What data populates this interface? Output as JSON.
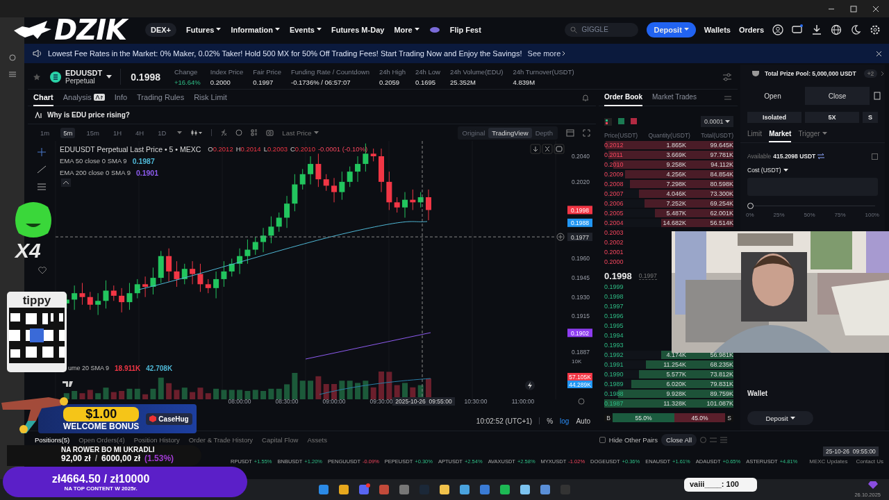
{
  "overlay_logo": {
    "text": "DZIK"
  },
  "nav": {
    "items": [
      {
        "label": "DEX+",
        "kind": "pill"
      },
      {
        "label": "Futures",
        "kind": "menu"
      },
      {
        "label": "Information",
        "kind": "menu"
      },
      {
        "label": "Events",
        "kind": "menu"
      },
      {
        "label": "Futures M-Day",
        "kind": "plain"
      },
      {
        "label": "More",
        "kind": "menu"
      },
      {
        "label": "Flip Fest",
        "kind": "promo"
      }
    ],
    "search": {
      "placeholder": "GIGGLE"
    },
    "deposit": "Deposit",
    "links": [
      "Wallets",
      "Orders"
    ]
  },
  "banner": {
    "text": "Lowest Fee Rates in the Market: 0% Maker, 0.02% Taker! Hold 500 MX for 50% Off Trading Fees! Start Trading Now and Enjoy the Savings!",
    "link": "See more"
  },
  "ticker": {
    "symbol": "EDUUSDT",
    "type": "Perpetual",
    "price": "0.1998",
    "stats": [
      {
        "label": "Change",
        "value": "+16.64%",
        "kind": "up"
      },
      {
        "label": "Index Price",
        "value": "0.2000",
        "kind": "plain"
      },
      {
        "label": "Fair Price",
        "value": "0.1997",
        "kind": "plain"
      },
      {
        "label": "Funding Rate / Countdown",
        "value": "-0.1736% / 06:57:07",
        "kind": "plain"
      },
      {
        "label": "24h High",
        "value": "0.2059",
        "kind": "plain"
      },
      {
        "label": "24h Low",
        "value": "0.1695",
        "kind": "plain"
      },
      {
        "label": "24h Volume(EDU)",
        "value": "25.352M",
        "kind": "plain"
      },
      {
        "label": "24h Turnover(USDT)",
        "value": "4.839M",
        "kind": "plain"
      }
    ]
  },
  "chart_tabs": [
    {
      "label": "Chart",
      "selected": true,
      "kind": "plain"
    },
    {
      "label": "Analysis",
      "selected": false,
      "kind": "ai"
    },
    {
      "label": "Info",
      "selected": false,
      "kind": "plain"
    },
    {
      "label": "Trading Rules",
      "selected": false,
      "kind": "plain"
    },
    {
      "label": "Risk Limit",
      "selected": false,
      "kind": "plain"
    }
  ],
  "insight": "Why is EDU price rising?",
  "intervals": [
    {
      "label": "1m",
      "selected": false
    },
    {
      "label": "5m",
      "selected": true
    },
    {
      "label": "15m",
      "selected": false
    },
    {
      "label": "1H",
      "selected": false
    },
    {
      "label": "4H",
      "selected": false
    },
    {
      "label": "1D",
      "selected": false
    }
  ],
  "price_source": "Last Price",
  "views": [
    {
      "label": "Original",
      "selected": false
    },
    {
      "label": "TradingView",
      "selected": true
    },
    {
      "label": "Depth",
      "selected": false
    }
  ],
  "chart": {
    "legend_title": "EDUUSDT Perpetual Last Price • 5 • MEXC",
    "ohlc": [
      {
        "label": "O",
        "value": "0.2012"
      },
      {
        "label": "H",
        "value": "0.2014"
      },
      {
        "label": "L",
        "value": "0.2003"
      },
      {
        "label": "C",
        "value": "0.2010"
      }
    ],
    "change": "-0.0001 (-0.10%)",
    "indicators": [
      {
        "label": "EMA 50 close 0 SMA 9",
        "value": "0.1987",
        "color": "#4fb8d6"
      },
      {
        "label": "EMA 200 close 0 SMA 9",
        "value": "0.1901",
        "color": "#8e5cf0"
      }
    ],
    "volume_label": "ume 20 SMA 9",
    "volume_values": [
      {
        "value": "18.911K",
        "color": "#f23645"
      },
      {
        "value": "42.708K",
        "color": "#4fb8d6"
      }
    ],
    "price_ticks": [
      "0.2040",
      "0.2020",
      "0.1960",
      "0.1945",
      "0.1930",
      "0.1915",
      "0.1887"
    ],
    "price_tags": [
      {
        "label": "0.1998",
        "kind": "tag",
        "color": "#f23645"
      },
      {
        "label": "0.1988",
        "kind": "tag",
        "color": "#2196f3"
      },
      {
        "label": "0.1977",
        "kind": "crosshair"
      },
      {
        "label": "0.1902",
        "kind": "tag",
        "color": "#8e3cf0"
      }
    ],
    "volume_tick": "10K",
    "volume_tags": [
      {
        "label": "57.105K",
        "color": "#f23645"
      },
      {
        "label": "44.289K",
        "color": "#2196f3"
      }
    ],
    "time_ticks": [
      "08:00:00",
      "08:30:00",
      "09:00:00",
      "09:30:00",
      "10:30:00",
      "11:00:00"
    ],
    "crosshair_time": "2025-10-26  09:55:00",
    "footer": {
      "time": "10:02:52 (UTC+1)",
      "options": [
        {
          "label": "%",
          "selected": false
        },
        {
          "label": "log",
          "selected": true
        },
        {
          "label": "Auto",
          "selected": false
        }
      ]
    }
  },
  "order_book": {
    "tabs": [
      {
        "label": "Order Book",
        "selected": true
      },
      {
        "label": "Market Trades",
        "selected": false
      }
    ],
    "precision": "0.0001",
    "columns": [
      "Price(USDT)",
      "Quantity(USDT)",
      "Total(USDT)"
    ],
    "asks": [
      {
        "price": "0.2012",
        "quantity": "1.865K",
        "total": "99.645K",
        "level": 0.99
      },
      {
        "price": "0.2011",
        "quantity": "3.669K",
        "total": "97.781K",
        "level": 0.97
      },
      {
        "price": "0.2010",
        "quantity": "9.258K",
        "total": "94.112K",
        "level": 0.93
      },
      {
        "price": "0.2009",
        "quantity": "4.256K",
        "total": "84.854K",
        "level": 0.84
      },
      {
        "price": "0.2008",
        "quantity": "7.298K",
        "total": "80.598K",
        "level": 0.8
      },
      {
        "price": "0.2007",
        "quantity": "4.046K",
        "total": "73.300K",
        "level": 0.73
      },
      {
        "price": "0.2006",
        "quantity": "7.252K",
        "total": "69.254K",
        "level": 0.69
      },
      {
        "price": "0.2005",
        "quantity": "5.487K",
        "total": "62.001K",
        "level": 0.61
      },
      {
        "price": "0.2004",
        "quantity": "14.682K",
        "total": "56.514K",
        "level": 0.56
      },
      {
        "price": "0.2003"
      },
      {
        "price": "0.2002"
      },
      {
        "price": "0.2001"
      },
      {
        "price": "0.2000"
      }
    ],
    "last": "0.1998",
    "mark": "0.1997",
    "bids": [
      {
        "price": "0.1999"
      },
      {
        "price": "0.1998"
      },
      {
        "price": "0.1997"
      },
      {
        "price": "0.1996"
      },
      {
        "price": "0.1995"
      },
      {
        "price": "0.1994"
      },
      {
        "price": "0.1993"
      },
      {
        "price": "0.1992",
        "quantity": "4.174K",
        "total": "56.981K",
        "level": 0.56
      },
      {
        "price": "0.1991",
        "quantity": "11.254K",
        "total": "68.235K",
        "level": 0.68
      },
      {
        "price": "0.1990",
        "quantity": "5.577K",
        "total": "73.812K",
        "level": 0.73
      },
      {
        "price": "0.1989",
        "quantity": "6.020K",
        "total": "79.831K",
        "level": 0.79
      },
      {
        "price": "0.1988",
        "quantity": "9.928K",
        "total": "89.759K",
        "level": 0.89
      },
      {
        "price": "0.1987",
        "quantity": "11.328K",
        "total": "101.087K",
        "level": 1
      }
    ],
    "ratio": {
      "buy_label": "B",
      "buy": "55.0%",
      "sell": "45.0%",
      "sell_label": "S",
      "level": 0.55
    }
  },
  "trade": {
    "prize_pool": "Total Prize Pool: 5,000,000 USDT",
    "prize_badge": "+2",
    "sides": [
      {
        "label": "Open",
        "selected": true
      },
      {
        "label": "Close",
        "selected": false
      }
    ],
    "margin": [
      "Isolated",
      "5X",
      "S"
    ],
    "order_types": [
      {
        "label": "Limit",
        "selected": false
      },
      {
        "label": "Market",
        "selected": true
      },
      {
        "label": "Trigger",
        "selected": false,
        "dropdown": true
      }
    ],
    "available_label": "Available",
    "available": "415.2098 USDT",
    "cost_label": "Cost (USDT)",
    "slider": {
      "level": 0,
      "marks": [
        "0%",
        "25%",
        "50%",
        "75%",
        "100%"
      ]
    },
    "wallet_title": "Wallet",
    "wallet_button": "Deposit",
    "chart_time": "25-10-26  09:55:00"
  },
  "positions": {
    "tabs": [
      {
        "label": "Positions(5)",
        "selected": true
      },
      {
        "label": "Open Orders(4)",
        "selected": false
      },
      {
        "label": "Position History",
        "selected": false
      },
      {
        "label": "Order & Trade History",
        "selected": false
      },
      {
        "label": "Capital Flow",
        "selected": false
      },
      {
        "label": "Assets",
        "selected": false
      }
    ],
    "hide_other": {
      "label": "Hide Other Pairs",
      "checked": false
    },
    "close_all": "Close All"
  },
  "market_strip": {
    "items": [
      {
        "symbol": "RPUSDT",
        "change": "+1.55%",
        "up": true
      },
      {
        "symbol": "BNBUSDT",
        "change": "+1.20%",
        "up": true
      },
      {
        "symbol": "PENGUUSDT",
        "change": "-0.09%",
        "up": false
      },
      {
        "symbol": "PEPEUSDT",
        "change": "+0.30%",
        "up": true
      },
      {
        "symbol": "APTUSDT",
        "change": "+2.54%",
        "up": true
      },
      {
        "symbol": "AVAXUSDT",
        "change": "+2.58%",
        "up": true
      },
      {
        "symbol": "MYXUSDT",
        "change": "-1.02%",
        "up": false
      },
      {
        "symbol": "DOGEUSDT",
        "change": "+0.36%",
        "up": true
      },
      {
        "symbol": "ENAUSDT",
        "change": "+1.61%",
        "up": true
      },
      {
        "symbol": "ADAUSDT",
        "change": "+0.65%",
        "up": true
      },
      {
        "symbol": "ASTERUSDT",
        "change": "+4.81%",
        "up": true
      }
    ],
    "links": [
      "MEXC Updates",
      "Contact Us"
    ]
  },
  "stream": {
    "multiplier": "X4",
    "tip_brand": "tippy",
    "bonus": {
      "amount": "$1.00",
      "caption": "WELCOME BONUS",
      "brand": "CaseHug"
    },
    "goal": {
      "title": "NA ROWER BO MI UKRADLI",
      "current": "92,00 zł",
      "separator": "/",
      "target": "6000,00 zł",
      "percent": "(1.53%)"
    },
    "top_goal": {
      "amount": "zł4664.50 / zł10000",
      "caption": "NA TOP CONTENT W 2025r."
    },
    "chat": "vaiii____: 100"
  },
  "taskbar": {
    "date": "26.10.2025"
  }
}
